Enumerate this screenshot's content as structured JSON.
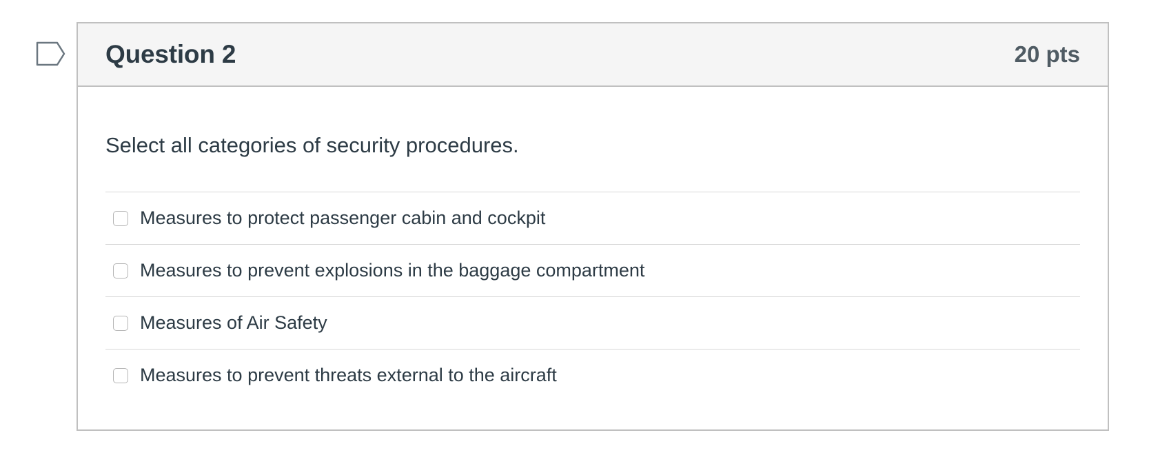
{
  "flag": {
    "icon": "flag-question-icon"
  },
  "question": {
    "title": "Question 2",
    "points": "20 pts",
    "text": "Select all categories of security procedures.",
    "answers": [
      {
        "label": "Measures to protect passenger cabin and cockpit",
        "checked": false
      },
      {
        "label": "Measures to prevent explosions in the baggage compartment",
        "checked": false
      },
      {
        "label": "Measures of Air Safety",
        "checked": false
      },
      {
        "label": "Measures to prevent threats external to the aircraft",
        "checked": false
      }
    ]
  },
  "colors": {
    "text": "#2d3b45",
    "header_bg": "#f5f5f5",
    "border": "#c0c0c0",
    "flag_stroke": "#6b7780"
  }
}
